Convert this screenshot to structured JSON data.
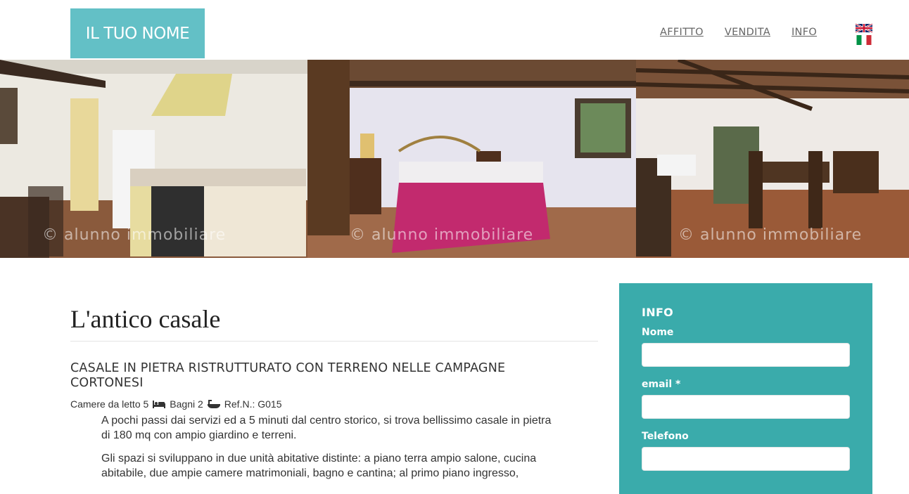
{
  "header": {
    "logo_text": "IL TUO NOME",
    "nav": [
      {
        "label": "AFFITTO"
      },
      {
        "label": "VENDITA"
      },
      {
        "label": "INFO"
      }
    ],
    "languages": [
      "uk-flag-icon",
      "italy-flag-icon"
    ]
  },
  "gallery": {
    "watermarks": [
      "© alunno immobiliare",
      "© alunno immobiliare",
      "© alunno immobiliare"
    ]
  },
  "listing": {
    "title": "L'antico casale",
    "subtitle": "CASALE IN PIETRA RISTRUTTURATO CON TERRENO NELLE CAMPAGNE CORTONESI",
    "bedrooms": "Camere da letto 5",
    "bathrooms": "Bagni 2",
    "ref": "Ref.N.: G015",
    "paragraphs": [
      "A pochi passi dai servizi ed a 5 minuti dal centro storico, si trova bellissimo casale in pietra di 180 mq con ampio giardino e terreni.",
      "Gli spazi si sviluppano in due unità abitative distinte: a piano terra ampio salone, cucina abitabile, due ampie camere matrimoniali, bagno e cantina; al primo piano ingresso,"
    ]
  },
  "contact_form": {
    "title": "INFO",
    "name_label": "Nome",
    "email_label": "email *",
    "phone_label": "Telefono"
  },
  "colors": {
    "logo_bg": "#63c0c6",
    "form_bg": "#3aabab"
  }
}
